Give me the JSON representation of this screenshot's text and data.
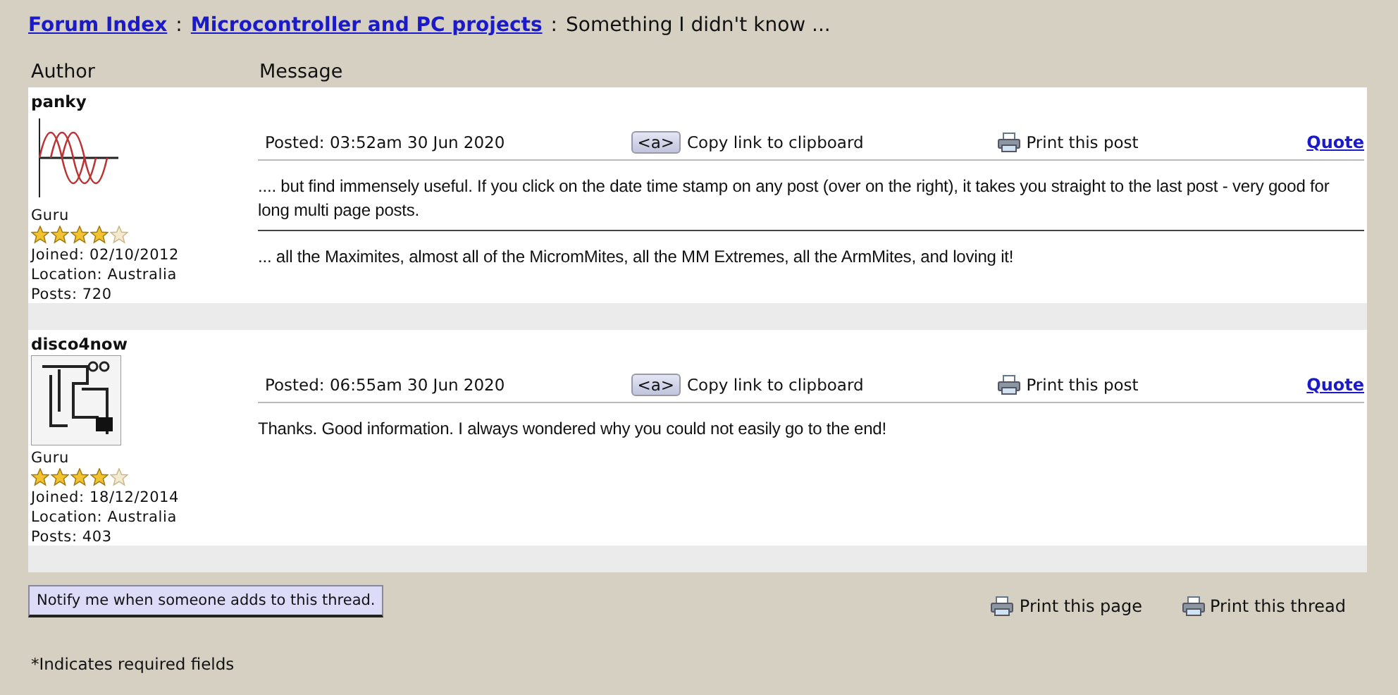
{
  "breadcrumb": {
    "links": [
      "Forum Index",
      "Microcontroller and PC projects"
    ],
    "separator": ":",
    "current": "Something I didn't know ..."
  },
  "columns": [
    "Author",
    "Message"
  ],
  "posts": [
    {
      "author": "panky",
      "avatar": {
        "kind": "picture"
      },
      "rank": "Guru",
      "stars": 4,
      "joined": "Joined: 02/10/2012",
      "location": "Location: Australia",
      "posts": "Posts: 720",
      "posted": "Posted: 03:52am 30 Jun 2020",
      "copy_key": "<a>",
      "copy_label": "Copy link to clipboard",
      "print_label": "Print this post",
      "quote": "Quote",
      "paragraphs": [
        ".... but find immensely useful.  If you click on the date time stamp on any post (over on the right), it takes you straight to the last post - very good for long multi page posts.",
        "... all the Maximites, almost all of the MicromMites, all the MM Extremes, all the ArmMites, and loving it!"
      ]
    },
    {
      "author": "disco4now",
      "avatar": {
        "kind": "picture"
      },
      "rank": "Guru",
      "stars": 4,
      "joined": "Joined: 18/12/2014",
      "location": "Location: Australia",
      "posts": "Posts: 403",
      "posted": "Posted: 06:55am 30 Jun 2020",
      "copy_key": "<a>",
      "copy_label": "Copy link to clipboard",
      "print_label": "Print this post",
      "quote": "Quote",
      "paragraphs": [
        "Thanks. Good information. I always wondered why you could not easily go to the end!"
      ]
    }
  ],
  "notify_button": "Notify me when someone adds to this thread.",
  "print_links": [
    "Print this page",
    "Print this thread"
  ],
  "footnote": "*Indicates required fields"
}
